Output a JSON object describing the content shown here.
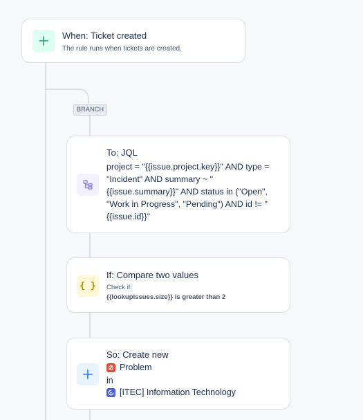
{
  "trigger": {
    "title": "When: Ticket created",
    "description": "The rule runs when tickets are created.",
    "icon": "plus-icon",
    "icon_color": "#22a06b",
    "icon_bg": "#dcfff1"
  },
  "branch": {
    "label": "BRANCH"
  },
  "jql_step": {
    "title": "To: JQL",
    "query": "project = \"{{issue.project.key}}\" AND type = \"Incident\" AND summary ~ \"{{issue.summary}}\" AND status in (\"Open\", \"Work in Progress\", \"Pending\") AND id != \"{{issue.id}}\"",
    "icon": "branch-tree-icon",
    "icon_color": "#8f7ee7",
    "icon_bg": "#f3f0ff"
  },
  "condition_step": {
    "title": "If: Compare two values",
    "check_label": "Check if:",
    "expression": "{{lookupIssues.size}} is greater than 2",
    "icon": "curly-braces-icon",
    "icon_color": "#b38600",
    "icon_bg": "#fff7d6"
  },
  "action_step": {
    "title": "So: Create new",
    "issue_type": "Problem",
    "issue_type_color": "#e34935",
    "in_label": "in",
    "project": "[ITEC] Information Technology",
    "project_icon_color": "#4c5fd5",
    "icon": "plus-icon",
    "icon_color": "#1d7afc",
    "icon_bg": "#e9f2ff"
  }
}
